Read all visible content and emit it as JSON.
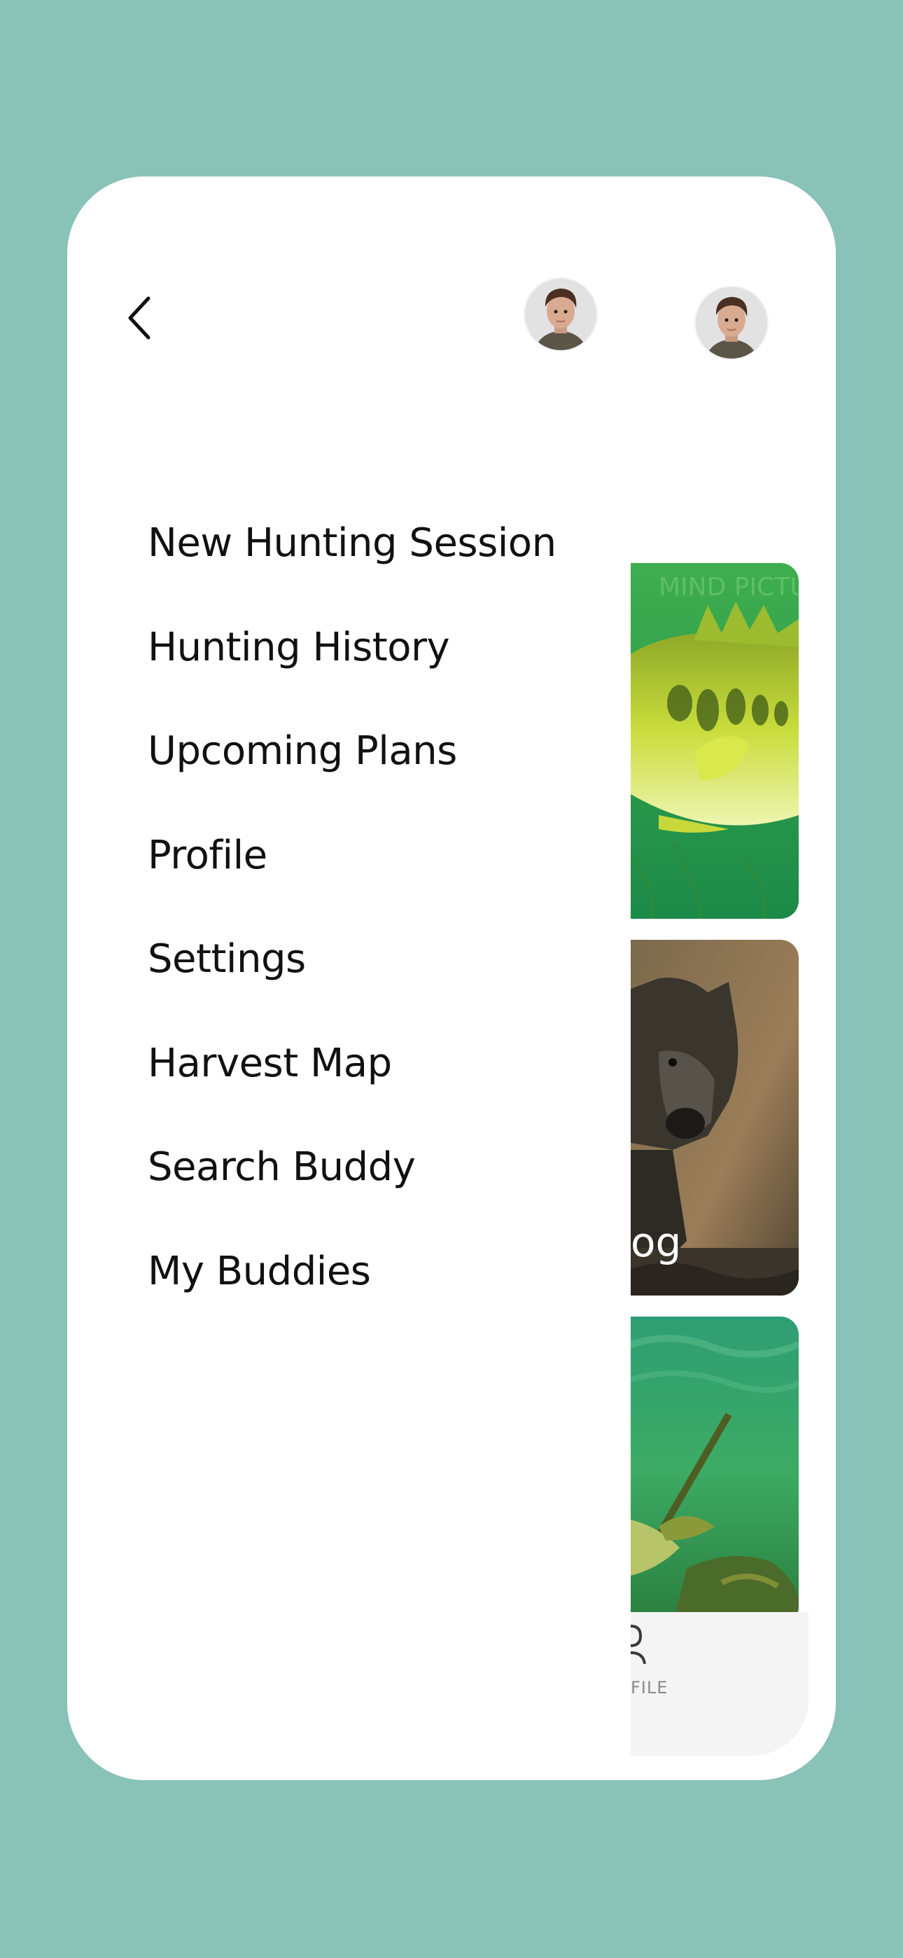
{
  "menu": {
    "items": [
      {
        "label": "New Hunting Session"
      },
      {
        "label": "Hunting History"
      },
      {
        "label": "Upcoming Plans"
      },
      {
        "label": "Profile"
      },
      {
        "label": "Settings"
      },
      {
        "label": "Harvest Map"
      },
      {
        "label": "Search Buddy"
      },
      {
        "label": "My Buddies"
      }
    ]
  },
  "background": {
    "cards": [
      {
        "image": "largemouth-bass-photo",
        "label": ""
      },
      {
        "image": "wild-boar-photo",
        "label": "og"
      },
      {
        "image": "underwater-pike-photo",
        "label": ""
      }
    ],
    "tabbar": {
      "profile_label": "FILE"
    },
    "watermark": "MIND PICTUR"
  },
  "colors": {
    "page_background": "#89c2b6",
    "panel": "#ffffff",
    "text": "#111111",
    "tab_label": "#8a8a8a"
  },
  "icons": [
    "chevron-left-icon",
    "avatar",
    "profile-icon"
  ]
}
